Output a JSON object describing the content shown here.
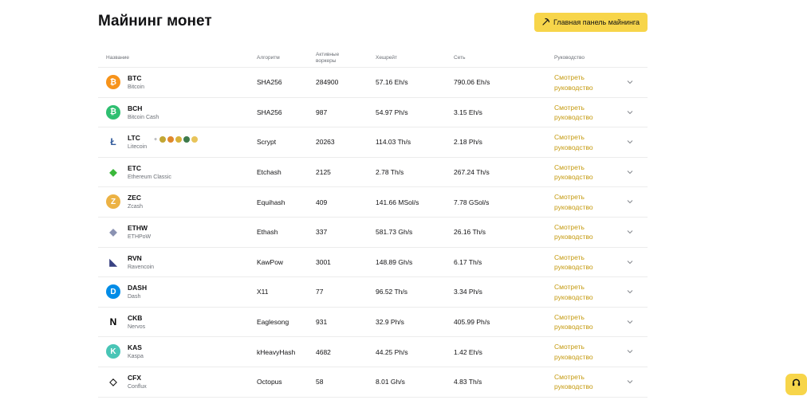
{
  "page": {
    "title": "Майнинг монет",
    "dashboard_button": "Главная панель майнинга"
  },
  "table": {
    "headers": {
      "name": "Название",
      "algorithm": "Алгоритм",
      "workers": "Активные воркеры",
      "hashrate": "Хешрейт",
      "network": "Сеть",
      "guide": "Руководство"
    },
    "rows": [
      {
        "symbol": "BTC",
        "name": "Bitcoin",
        "algorithm": "SHA256",
        "workers": "284900",
        "hashrate": "57.16 Eh/s",
        "network": "790.06 Eh/s",
        "guide": "Смотреть руководство",
        "icon": "bitcoin-icon",
        "color": "#f7931a"
      },
      {
        "symbol": "BCH",
        "name": "Bitcoin Cash",
        "algorithm": "SHA256",
        "workers": "987",
        "hashrate": "54.97 Ph/s",
        "network": "3.15 Eh/s",
        "guide": "Смотреть руководство",
        "icon": "bitcoin-cash-icon",
        "color": "#2fbf71"
      },
      {
        "symbol": "LTC",
        "name": "Litecoin",
        "algorithm": "Scrypt",
        "workers": "20263",
        "hashrate": "114.03 Th/s",
        "network": "2.18 Ph/s",
        "guide": "Смотреть руководство",
        "icon": "litecoin-icon",
        "color": "#345d9d"
      },
      {
        "symbol": "ETC",
        "name": "Ethereum Classic",
        "algorithm": "Etchash",
        "workers": "2125",
        "hashrate": "2.78 Th/s",
        "network": "267.24 Th/s",
        "guide": "Смотреть руководство",
        "icon": "ethereum-classic-icon",
        "color": "#3ab83a"
      },
      {
        "symbol": "ZEC",
        "name": "Zcash",
        "algorithm": "Equihash",
        "workers": "409",
        "hashrate": "141.66 MSol/s",
        "network": "7.78 GSol/s",
        "guide": "Смотреть руководство",
        "icon": "zcash-icon",
        "color": "#ecb244"
      },
      {
        "symbol": "ETHW",
        "name": "ETHPoW",
        "algorithm": "Ethash",
        "workers": "337",
        "hashrate": "581.73 Gh/s",
        "network": "26.16 Th/s",
        "guide": "Смотреть руководство",
        "icon": "ethw-icon",
        "color": "#8a92b2"
      },
      {
        "symbol": "RVN",
        "name": "Ravencoin",
        "algorithm": "KawPow",
        "workers": "3001",
        "hashrate": "148.89 Gh/s",
        "network": "6.17 Th/s",
        "guide": "Смотреть руководство",
        "icon": "ravencoin-icon",
        "color": "#384182"
      },
      {
        "symbol": "DASH",
        "name": "Dash",
        "algorithm": "X11",
        "workers": "77",
        "hashrate": "96.52 Th/s",
        "network": "3.34 Ph/s",
        "guide": "Смотреть руководство",
        "icon": "dash-icon",
        "color": "#008ce7"
      },
      {
        "symbol": "CKB",
        "name": "Nervos",
        "algorithm": "Eaglesong",
        "workers": "931",
        "hashrate": "32.9 Ph/s",
        "network": "405.99 Ph/s",
        "guide": "Смотреть руководство",
        "icon": "nervos-icon",
        "color": "#000000"
      },
      {
        "symbol": "KAS",
        "name": "Kaspa",
        "algorithm": "kHeavyHash",
        "workers": "4682",
        "hashrate": "44.25 Ph/s",
        "network": "1.42 Eh/s",
        "guide": "Смотреть руководство",
        "icon": "kaspa-icon",
        "color": "#49c5b6"
      },
      {
        "symbol": "CFX",
        "name": "Conflux",
        "algorithm": "Octopus",
        "workers": "58",
        "hashrate": "8.01 Gh/s",
        "network": "4.83 Th/s",
        "guide": "Смотреть руководство",
        "icon": "conflux-icon",
        "color": "#1a1a1a"
      }
    ],
    "merged_mining": {
      "plus": "+",
      "coins": [
        {
          "icon": "dogecoin-icon",
          "color": "#c2a633"
        },
        {
          "icon": "bellscoin-icon",
          "color": "#e0882c"
        },
        {
          "icon": "pepecoin-icon",
          "color": "#d9b23a"
        },
        {
          "icon": "junkcoin-icon",
          "color": "#3d7a4a"
        },
        {
          "icon": "luckycoin-icon",
          "color": "#e8c45a"
        }
      ]
    }
  },
  "colors": {
    "accent": "#f7d54a",
    "link": "#c59a0e",
    "muted": "#6b6f76",
    "divider": "#ececec"
  },
  "icons": {
    "dashboard": "pickaxe-icon",
    "expand": "chevron-down-icon",
    "support": "headset-icon"
  }
}
